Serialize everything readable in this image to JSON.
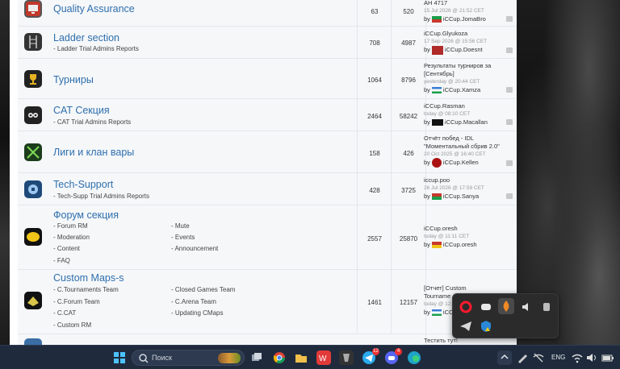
{
  "forums": [
    {
      "title": "Quality Assurance",
      "topics": "63",
      "posts": "520",
      "last_title": "AH 4717",
      "last_date": "15 Jul 2026 @ 21:52 CET",
      "by": "by",
      "last_user": "iCCup.JomaBro",
      "icon": "monitor-icon"
    },
    {
      "title": "Ladder section",
      "sub": "- Ladder Trial Admins Reports",
      "topics": "708",
      "posts": "4987",
      "last_title": "iCCup.Glyukoza",
      "last_date": "17 Sep 2026 @ 15:56 CET",
      "by": "by",
      "last_user": "iCCup.Doesnt",
      "icon": "ladder-icon"
    },
    {
      "title": "Турниры",
      "topics": "1064",
      "posts": "8796",
      "last_title": "Результаты турниров за",
      "last_title2": "[Сентябрь]",
      "last_date": "yesterday @ 20:44 CET",
      "by": "by",
      "last_user": "iCCup.Xamza",
      "icon": "trophy-icon"
    },
    {
      "title": "CAT Секция",
      "sub": "- CAT Trial Admins Reports",
      "topics": "2464",
      "posts": "58242",
      "last_title": "iCCup.Rasman",
      "last_date": "today @ 08:10 CET",
      "by": "by",
      "last_user": "iCCup.Macallan",
      "icon": "cat-icon"
    },
    {
      "title": "Лиги и клан вары",
      "topics": "158",
      "posts": "426",
      "last_title": "Отчёт побед - IDL",
      "last_title2": "\"Моментальный сбрив 2.0\"",
      "last_date": "20 Oct 2025 @ 16:40 CET",
      "by": "by",
      "last_user": "iCCup.Kellen",
      "icon": "swords-icon"
    },
    {
      "title": "Tech-Support",
      "sub": "- Tech-Supp Trial Admins Reports",
      "topics": "428",
      "posts": "3725",
      "last_title": "iccup.poo",
      "last_date": "26 Jul 2026 @ 17:59 CET",
      "by": "by",
      "last_user": "iCCup.Sanya",
      "icon": "tech-support-icon"
    },
    {
      "title": "Форум секция",
      "subs_left": [
        "- Forum RM",
        "- Moderation",
        "- Content",
        "- FAQ"
      ],
      "subs_right": [
        "- Mute",
        "- Events",
        "- Announcement"
      ],
      "topics": "2557",
      "posts": "25870",
      "last_title": "iCCup.oresh",
      "last_date": "today @ 11:11 CET",
      "by": "by",
      "last_user": "iCCup.oresh",
      "icon": "forum-icon"
    },
    {
      "title": "Custom Maps-s",
      "subs_left": [
        "- C.Tournaments Team",
        "- C.Forum Team",
        "- C.CAT",
        "- Custom RM"
      ],
      "subs_right": [
        "- Closed Games Team",
        "- C.Arena Team",
        "- Updating CMaps"
      ],
      "topics": "1461",
      "posts": "12157",
      "last_title": "[Отчет] Custom",
      "last_title2": "Tourname",
      "last_date": "today @ 12:",
      "by": "by",
      "last_user": "iCC",
      "icon": "custom-maps-icon"
    },
    {
      "last_title": "Тестить тут!"
    }
  ],
  "taskbar": {
    "search_placeholder": "Поиск",
    "lang": "ENG",
    "telegram_badge": "12",
    "discord_badge": "4"
  },
  "colors": {
    "link": "#2f6fad",
    "row_bg": "#f5f7f9",
    "taskbar": "#1f2b3d"
  }
}
